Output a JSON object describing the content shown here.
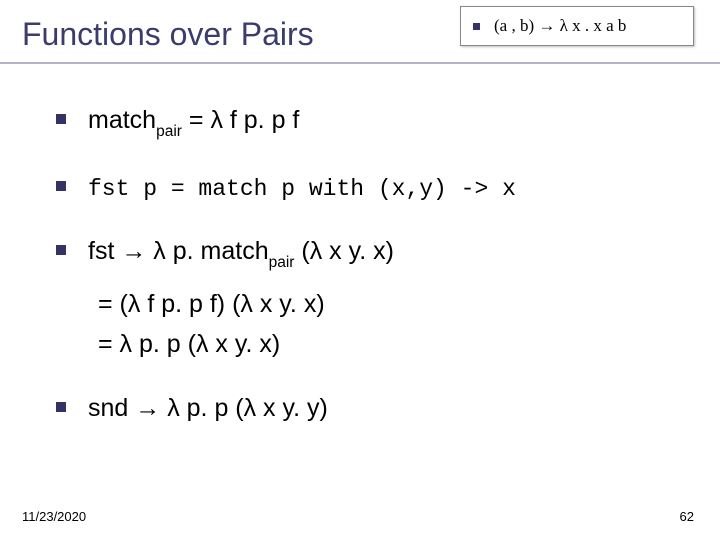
{
  "title": "Functions over Pairs",
  "inset": {
    "formula": "(a , b) → λ x . x a b"
  },
  "bullets": {
    "b1": {
      "text": "match",
      "sub": "pair",
      "rest": " = λ f p. p f"
    },
    "b2": {
      "code": "fst p = match p with (x,y) -> x"
    },
    "b3": {
      "lead": "fst → λ p. match",
      "sub": "pair",
      "tail": " (λ x y. x)",
      "line2": "= (λ f p. p f) (λ x y. x)",
      "line3": "= λ p. p (λ x y. x)"
    },
    "b4": {
      "text": "snd → λ p. p (λ x y. y)"
    }
  },
  "footer": {
    "date": "11/23/2020",
    "page": "62"
  }
}
